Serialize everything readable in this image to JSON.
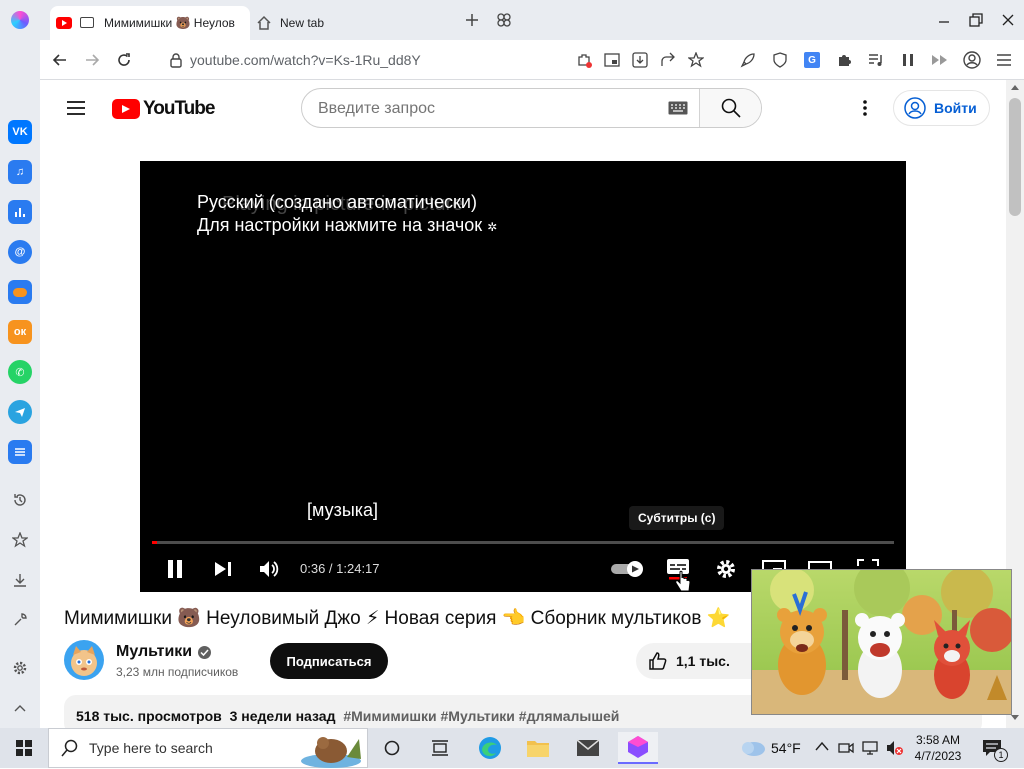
{
  "browser": {
    "tabs": [
      {
        "title": "Мимимишки 🐻 Неулов",
        "active": true
      },
      {
        "title": "New tab",
        "active": false
      }
    ],
    "url": "youtube.com/watch?v=Ks-1Ru_dd8Y"
  },
  "youtube": {
    "logo_text": "YouTube",
    "search_placeholder": "Введите запрос",
    "signin_label": "Войти",
    "subtitle_line1": "Русский (создано автоматически)",
    "subtitle_line2": "Для настройки нажмите на значок",
    "ghost_text": "Playing in picture-in-picture",
    "caption": "[музыка]",
    "tooltip": "Субтитры (c)",
    "time_display": "0:36 / 1:24:17",
    "progress": 0.007,
    "video_title": "Мимимишки 🐻 Неуловимый Джо ⚡ Новая серия 👈 Сборник мультиков ⭐",
    "channel_name": "Мультики",
    "subscribers": "3,23 млн подписчиков",
    "subscribe_label": "Подписаться",
    "likes": "1,1 тыс.",
    "views": "518 тыс. просмотров",
    "published": "3 недели назад",
    "hashtags": "#Мимимишки #Мультики #длямалышей"
  },
  "taskbar": {
    "search_placeholder": "Type here to search",
    "weather": "54°F",
    "time": "3:58 AM",
    "date": "4/7/2023",
    "notifications": "1"
  },
  "colors": {
    "yt_red": "#ff0000",
    "link_blue": "#065fd4",
    "vk": "#0077ff",
    "ok": "#f7931e",
    "whatsapp": "#25d366",
    "telegram": "#2aa3e0"
  }
}
